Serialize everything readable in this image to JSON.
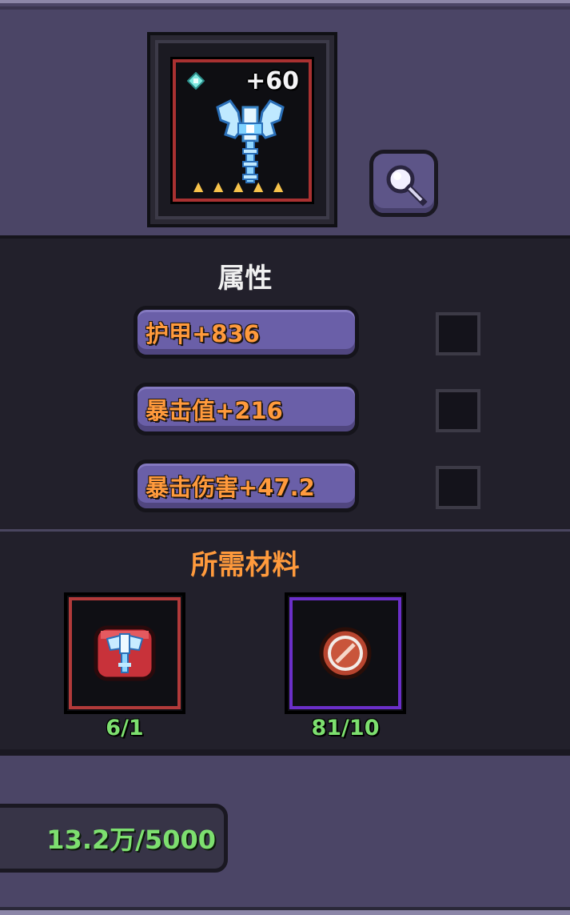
{
  "item": {
    "plus_level": "+60",
    "star_count": 5,
    "frame_color": "#a93131",
    "weapon_icon": "ice-halberd-icon",
    "gem_icon": "cyan-gem-icon"
  },
  "inspect": {
    "icon": "magnifier-icon"
  },
  "attributes": {
    "title": "属性",
    "title_color": "#f0f0f0",
    "rows": [
      {
        "text": "护甲+836"
      },
      {
        "text": "暴击值+216"
      },
      {
        "text": "暴击伤害+47.2"
      }
    ]
  },
  "materials": {
    "title": "所需材料",
    "title_color": "#ff9a3c",
    "items": [
      {
        "icon": "red-halberd-box-icon",
        "count": "6/1",
        "border_color": "#b13a3a"
      },
      {
        "icon": "red-scroll-orb-icon",
        "count": "81/10",
        "border_color": "#6b2fc9"
      }
    ]
  },
  "cost": {
    "text": "13.2万/5000",
    "color": "#7ddf6f"
  }
}
